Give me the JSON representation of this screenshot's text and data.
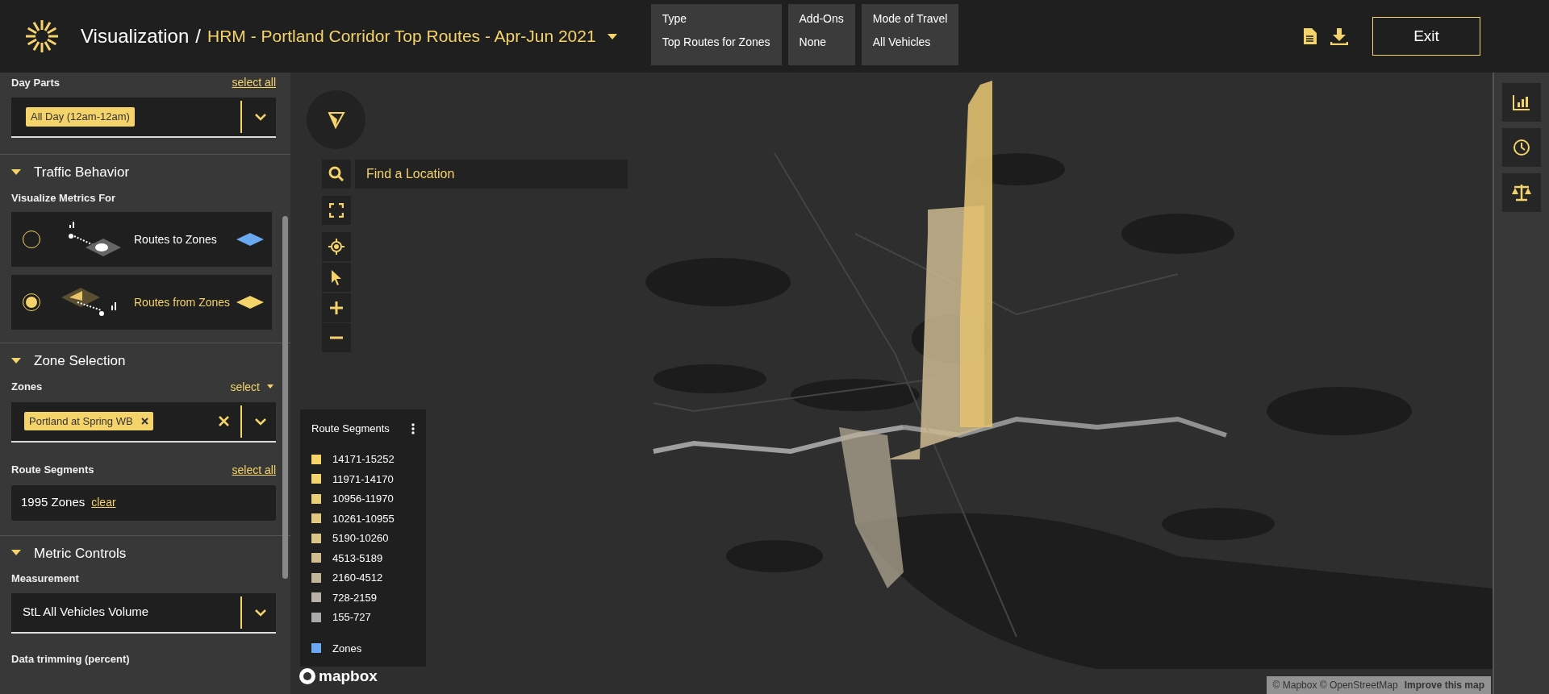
{
  "header": {
    "title": "Visualization",
    "separator": "/",
    "project": "HRM - Portland Corridor Top Routes - Apr-Jun 2021",
    "info": [
      {
        "label": "Type",
        "value": "Top Routes for Zones"
      },
      {
        "label": "Add-Ons",
        "value": "None"
      },
      {
        "label": "Mode of Travel",
        "value": "All Vehicles"
      }
    ],
    "exit": "Exit"
  },
  "sidebar": {
    "day_parts": {
      "label": "Day Parts",
      "action": "select all",
      "chip": "All Day (12am-12am)"
    },
    "sections": [
      {
        "title": "Traffic Behavior",
        "expanded": true,
        "label": "Visualize Metrics For",
        "options": [
          {
            "kind": "to",
            "label": "Routes to Zones",
            "selected": false,
            "color": "#6aa8f0"
          },
          {
            "kind": "from",
            "label": "Routes from Zones",
            "selected": true,
            "color": "#f5d36b"
          }
        ]
      },
      {
        "title": "Zone Selection",
        "expanded": true,
        "zones_label": "Zones",
        "zones_action": "select",
        "zone_chip": "Portland at Spring WB",
        "segments_label": "Route Segments",
        "segments_action": "select all",
        "segments_value": "1995 Zones",
        "segments_clear": "clear"
      },
      {
        "title": "Metric Controls",
        "expanded": true,
        "measurement_label": "Measurement",
        "measurement_value": "StL All Vehicles Volume",
        "trimming_label": "Data trimming (percent)"
      }
    ]
  },
  "map": {
    "search_placeholder": "Find a Location",
    "legend": {
      "title": "Route Segments",
      "items": [
        {
          "label": "14171-15252",
          "color": "#f7d56a"
        },
        {
          "label": "11971-14170",
          "color": "#f3d46f"
        },
        {
          "label": "10956-11970",
          "color": "#ebcf77"
        },
        {
          "label": "10261-10955",
          "color": "#e3ca80"
        },
        {
          "label": "5190-10260",
          "color": "#dac488"
        },
        {
          "label": "4513-5189",
          "color": "#d0bd90"
        },
        {
          "label": "2160-4512",
          "color": "#c4b69a"
        },
        {
          "label": "728-2159",
          "color": "#b8b1a5"
        },
        {
          "label": "155-727",
          "color": "#aaaaaa"
        }
      ],
      "zones": {
        "label": "Zones",
        "color": "#6aa8f0"
      }
    },
    "logo": "mapbox",
    "attribution": "© Mapbox © OpenStreetMap",
    "improve": "Improve this map"
  }
}
